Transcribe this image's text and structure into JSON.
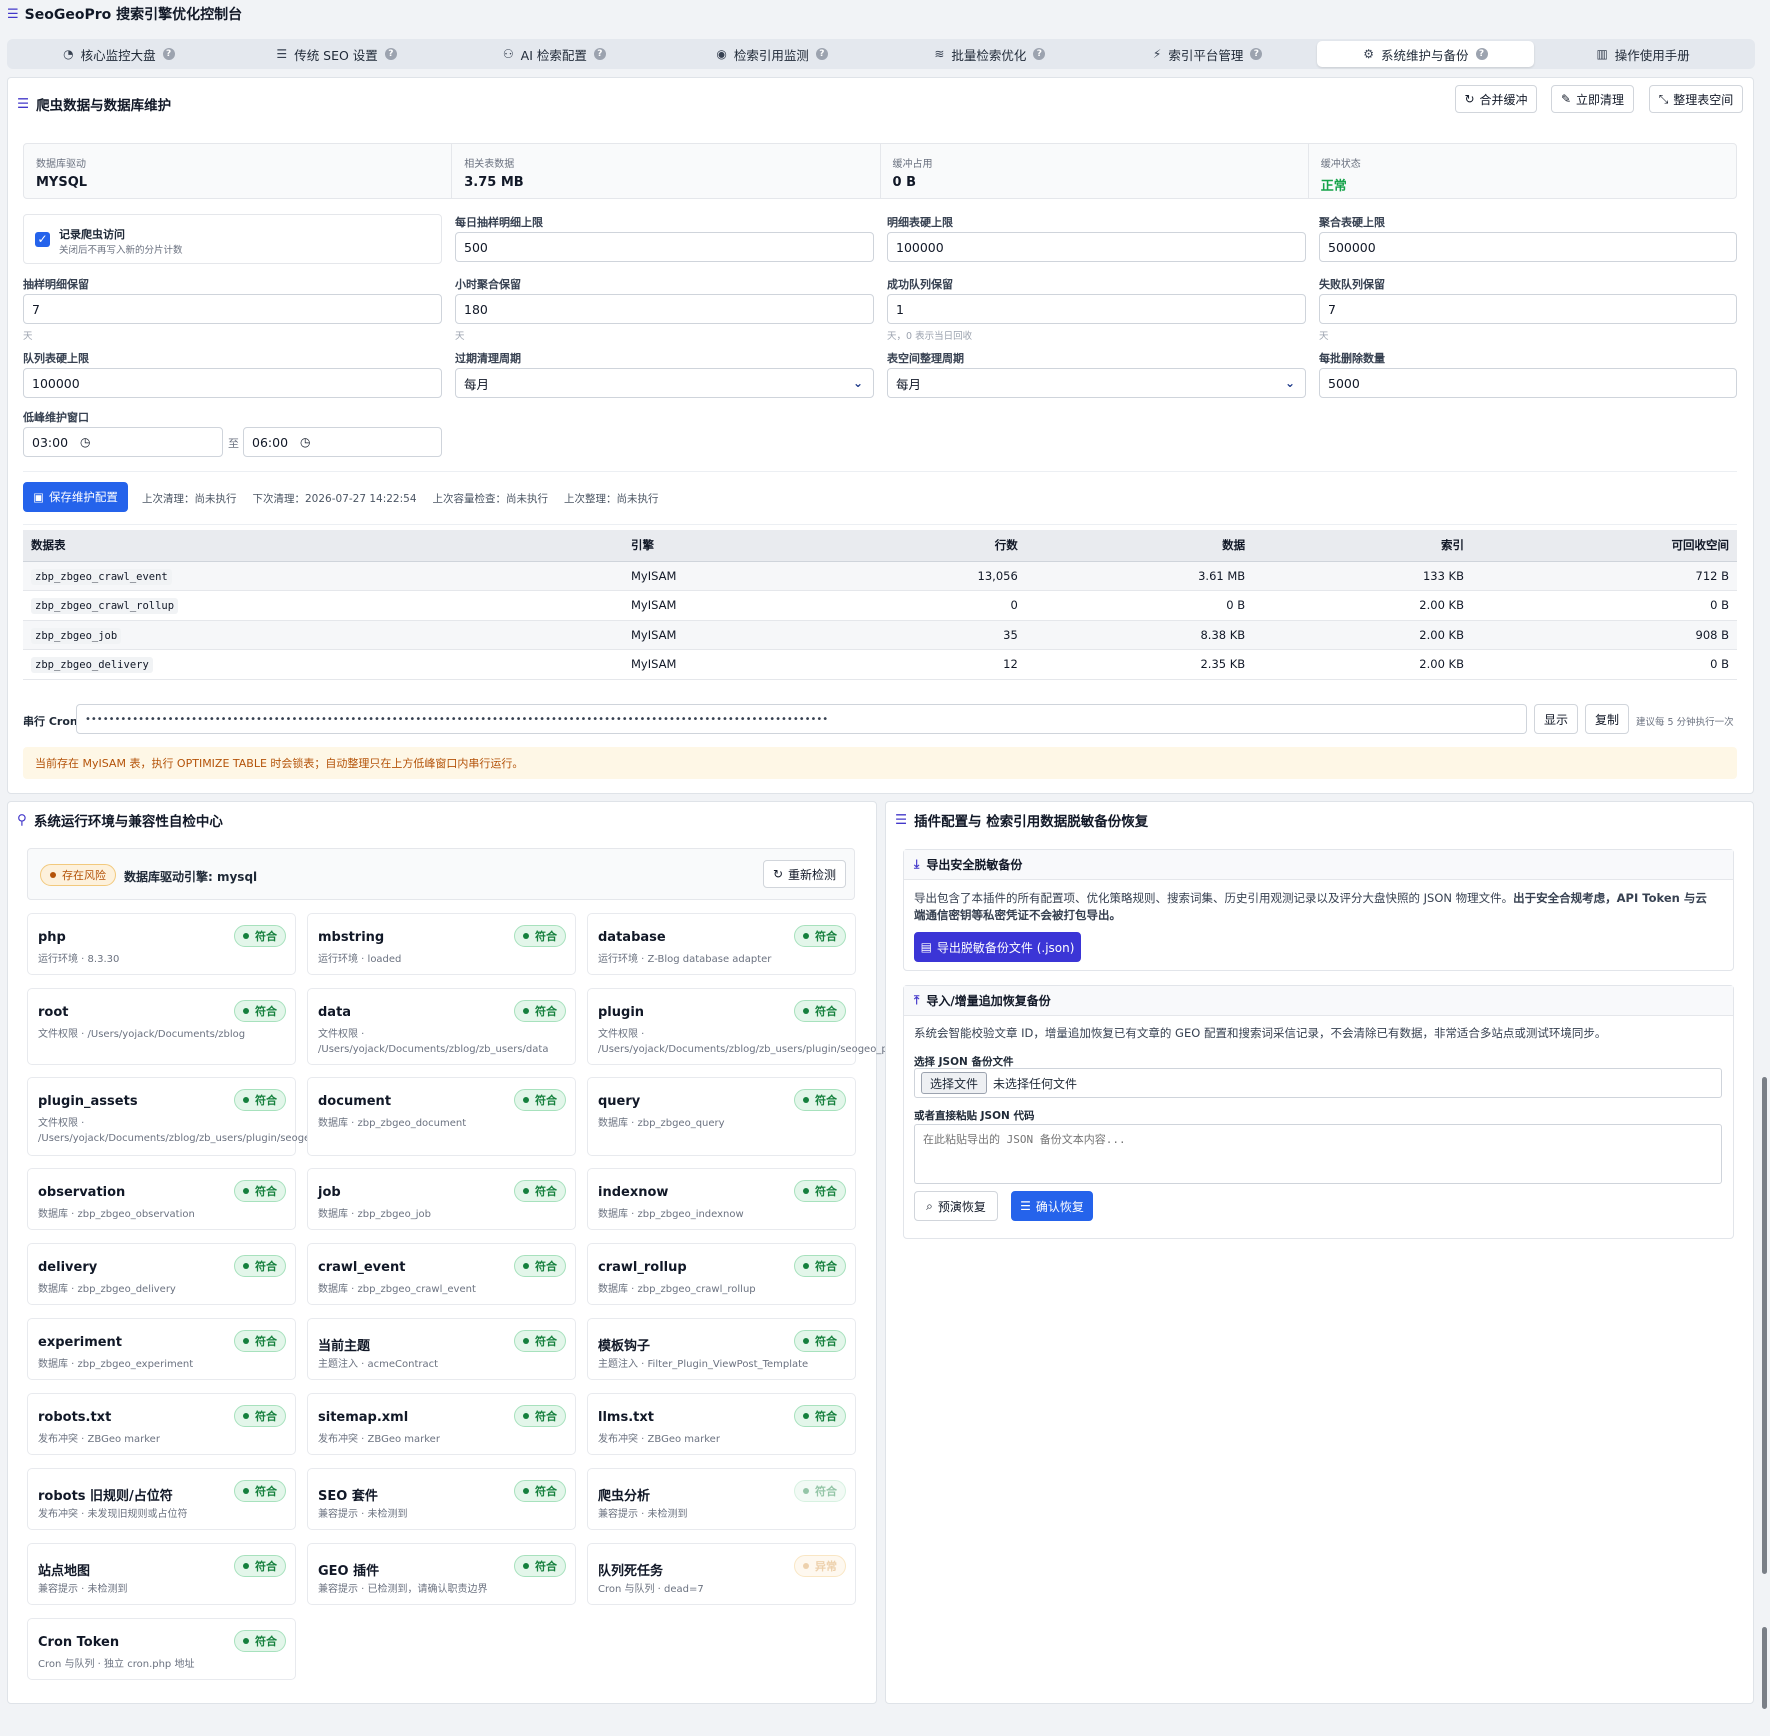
{
  "app": {
    "title": "SeoGeoPro 搜索引擎优化控制台"
  },
  "tabs": [
    {
      "label": "核心监控大盘",
      "icon": "◔"
    },
    {
      "label": "传统 SEO 设置",
      "icon": "☰"
    },
    {
      "label": "AI 检索配置",
      "icon": "⚇"
    },
    {
      "label": "检索引用监测",
      "icon": "◉"
    },
    {
      "label": "批量检索优化",
      "icon": "≋"
    },
    {
      "label": "索引平台管理",
      "icon": "⚡"
    },
    {
      "label": "系统维护与备份",
      "icon": "⚙"
    },
    {
      "label": "操作使用手册",
      "icon": "▥"
    }
  ],
  "help_glyph": "?",
  "db": {
    "title": "爬虫数据与数据库维护",
    "actions": {
      "merge": "合并缓冲",
      "clean": "立即清理",
      "optimize": "整理表空间"
    },
    "stats": [
      {
        "label": "数据库驱动",
        "value": "MYSQL"
      },
      {
        "label": "相关表数据",
        "value": "3.75 MB"
      },
      {
        "label": "缓冲占用",
        "value": "0 B"
      },
      {
        "label": "缓冲状态",
        "value": "正常"
      }
    ],
    "record": {
      "label": "记录爬虫访问",
      "hint": "关闭后不再写入新的分片计数",
      "checked": true
    },
    "fields": {
      "daily_sample": {
        "label": "每日抽样明细上限",
        "value": "500"
      },
      "detail_hard": {
        "label": "明细表硬上限",
        "value": "100000"
      },
      "rollup_hard": {
        "label": "聚合表硬上限",
        "value": "500000"
      },
      "sample_keep": {
        "label": "抽样明细保留",
        "value": "7",
        "hint": "天"
      },
      "hourly_keep": {
        "label": "小时聚合保留",
        "value": "180",
        "hint": "天"
      },
      "success_keep": {
        "label": "成功队列保留",
        "value": "1",
        "hint": "天，0 表示当日回收"
      },
      "fail_keep": {
        "label": "失败队列保留",
        "value": "7",
        "hint": "天"
      },
      "queue_hard": {
        "label": "队列表硬上限",
        "value": "100000"
      },
      "expire_cycle": {
        "label": "过期清理周期",
        "value": "每月"
      },
      "space_cycle": {
        "label": "表空间整理周期",
        "value": "每月"
      },
      "batch_delete": {
        "label": "每批删除数量",
        "value": "5000"
      },
      "window": {
        "label": "低峰维护窗口",
        "start": "03:00",
        "sep": "至",
        "end": "06:00"
      }
    },
    "save_label": "保存维护配置",
    "meta": [
      "上次清理：尚未执行",
      "下次清理：2026-07-27 14:22:54",
      "上次容量检查：尚未执行",
      "上次整理：尚未执行"
    ],
    "table": {
      "headers": [
        "数据表",
        "引擎",
        "行数",
        "数据",
        "索引",
        "可回收空间"
      ],
      "rows": [
        [
          "zbp_zbgeo_crawl_event",
          "MyISAM",
          "13,056",
          "3.61 MB",
          "133 KB",
          "712 B"
        ],
        [
          "zbp_zbgeo_crawl_rollup",
          "MyISAM",
          "0",
          "0 B",
          "2.00 KB",
          "0 B"
        ],
        [
          "zbp_zbgeo_job",
          "MyISAM",
          "35",
          "8.38 KB",
          "2.00 KB",
          "908 B"
        ],
        [
          "zbp_zbgeo_delivery",
          "MyISAM",
          "12",
          "2.35 KB",
          "2.00 KB",
          "0 B"
        ]
      ]
    },
    "cron": {
      "label": "串行 Cron",
      "mask": "••••••••••••••••••••••••••••••••••••••••••••••••••••••••••••••••••••••••••••••••••••••••••••••••••••••••••••••••••••••••••••••",
      "show": "显示",
      "copy": "复制",
      "hint": "建议每 5 分钟执行一次"
    },
    "warning": "当前存在 MyISAM 表，执行 OPTIMIZE TABLE 时会锁表；自动整理只在上方低峰窗口内串行运行。"
  },
  "env": {
    "title": "系统运行环境与兼容性自检中心",
    "risk_badge": "存在风险",
    "driver": "数据库驱动引擎: mysql",
    "recheck": "重新检测",
    "ok_label": "符合",
    "bad_label": "异常",
    "checks": [
      {
        "name": "php",
        "desc": "运行环境 · 8.3.30",
        "status": "ok"
      },
      {
        "name": "mbstring",
        "desc": "运行环境 · loaded",
        "status": "ok"
      },
      {
        "name": "database",
        "desc": "运行环境 · Z-Blog database adapter",
        "status": "ok"
      },
      {
        "name": "root",
        "desc": "文件权限 · /Users/yojack/Documents/zblog",
        "status": "ok"
      },
      {
        "name": "data",
        "desc": "文件权限 · /Users/yojack/Documents/zblog/zb_users/data",
        "status": "ok"
      },
      {
        "name": "plugin",
        "desc": "文件权限 · /Users/yojack/Documents/zblog/zb_users/plugin/seogeo_pro",
        "status": "ok"
      },
      {
        "name": "plugin_assets",
        "desc": "文件权限 · /Users/yojack/Documents/zblog/zb_users/plugin/seogeo_pro/assets",
        "status": "ok"
      },
      {
        "name": "document",
        "desc": "数据库 · zbp_zbgeo_document",
        "status": "ok"
      },
      {
        "name": "query",
        "desc": "数据库 · zbp_zbgeo_query",
        "status": "ok"
      },
      {
        "name": "observation",
        "desc": "数据库 · zbp_zbgeo_observation",
        "status": "ok"
      },
      {
        "name": "job",
        "desc": "数据库 · zbp_zbgeo_job",
        "status": "ok"
      },
      {
        "name": "indexnow",
        "desc": "数据库 · zbp_zbgeo_indexnow",
        "status": "ok"
      },
      {
        "name": "delivery",
        "desc": "数据库 · zbp_zbgeo_delivery",
        "status": "ok"
      },
      {
        "name": "crawl_event",
        "desc": "数据库 · zbp_zbgeo_crawl_event",
        "status": "ok"
      },
      {
        "name": "crawl_rollup",
        "desc": "数据库 · zbp_zbgeo_crawl_rollup",
        "status": "ok"
      },
      {
        "name": "experiment",
        "desc": "数据库 · zbp_zbgeo_experiment",
        "status": "ok"
      },
      {
        "name": "当前主题",
        "desc": "主题注入 · acmeContract",
        "status": "ok"
      },
      {
        "name": "模板钩子",
        "desc": "主题注入 · Filter_Plugin_ViewPost_Template",
        "status": "ok"
      },
      {
        "name": "robots.txt",
        "desc": "发布冲突 · ZBGeo marker",
        "status": "ok"
      },
      {
        "name": "sitemap.xml",
        "desc": "发布冲突 · ZBGeo marker",
        "status": "ok"
      },
      {
        "name": "llms.txt",
        "desc": "发布冲突 · ZBGeo marker",
        "status": "ok"
      },
      {
        "name": "robots 旧规则/占位符",
        "desc": "发布冲突 · 未发现旧规则或占位符",
        "status": "ok"
      },
      {
        "name": "SEO 套件",
        "desc": "兼容提示 · 未检测到",
        "status": "ok"
      },
      {
        "name": "爬虫分析",
        "desc": "兼容提示 · 未检测到",
        "status": "faded"
      },
      {
        "name": "站点地图",
        "desc": "兼容提示 · 未检测到",
        "status": "ok"
      },
      {
        "name": "GEO 插件",
        "desc": "兼容提示 · 已检测到，请确认职责边界",
        "status": "ok"
      },
      {
        "name": "队列死任务",
        "desc": "Cron 与队列 · dead=7",
        "status": "bad"
      },
      {
        "name": "Cron Token",
        "desc": "Cron 与队列 · 独立 cron.php 地址",
        "status": "ok"
      }
    ]
  },
  "backup": {
    "title": "插件配置与 检索引用数据脱敏备份恢复",
    "export": {
      "title": "导出安全脱敏备份",
      "desc": "导出包含了本插件的所有配置项、优化策略规则、搜索词集、历史引用观测记录以及评分大盘快照的 JSON 物理文件。",
      "desc_bold": "出于安全合规考虑，API Token 与云端通信密钥等私密凭证不会被打包导出。",
      "button": "导出脱敏备份文件 (.json)"
    },
    "import": {
      "title": "导入/增量追加恢复备份",
      "desc": "系统会智能校验文章 ID，增量追加恢复已有文章的 GEO 配置和搜索词采信记录，不会清除已有数据，非常适合多站点或测试环境同步。",
      "file_label": "选择 JSON 备份文件",
      "file_button": "选择文件",
      "file_none": "未选择任何文件",
      "paste_label": "或者直接粘贴 JSON 代码",
      "placeholder": "在此粘贴导出的 JSON 备份文本内容...",
      "preview": "预演恢复",
      "confirm": "确认恢复"
    }
  },
  "colors": {
    "primary": "#2563eb",
    "indigo": "#3b35d6",
    "ok": "#16a34a",
    "warn": "#b45309"
  }
}
